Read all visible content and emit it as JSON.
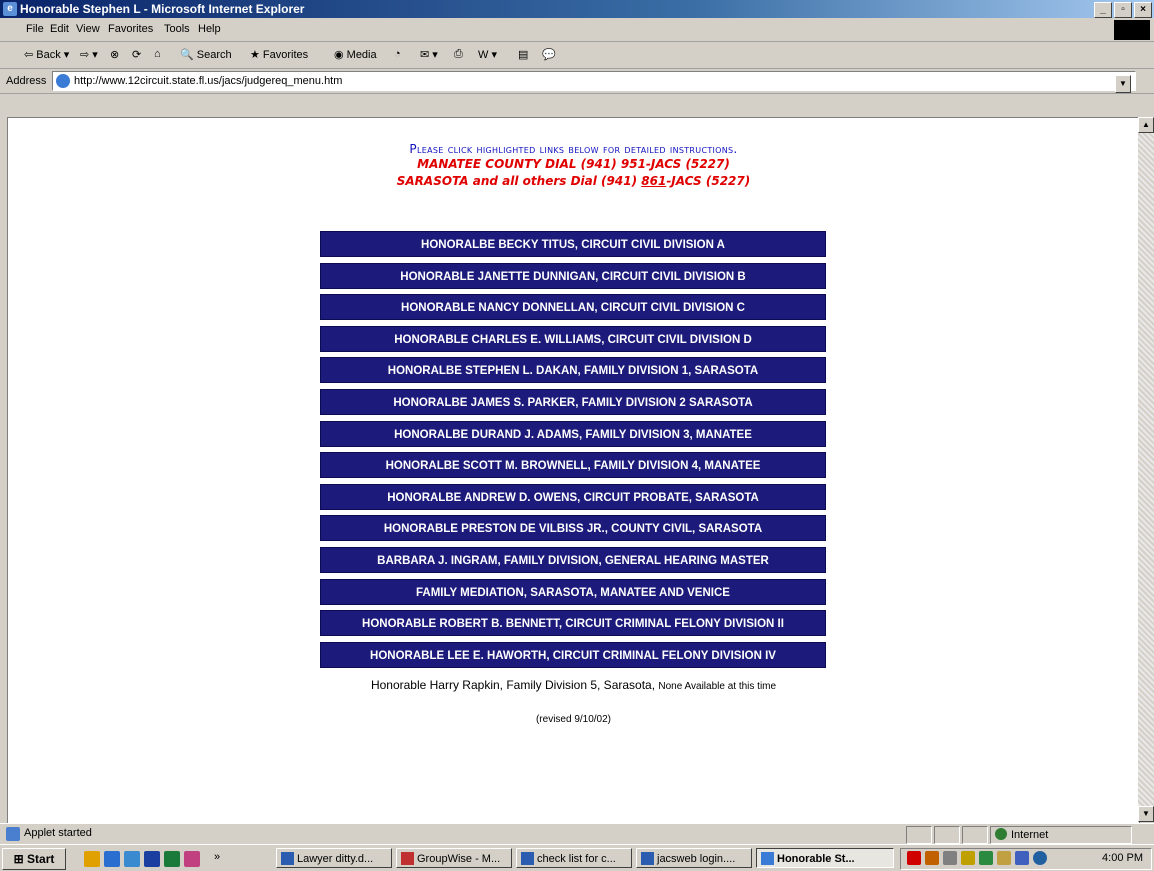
{
  "window": {
    "title": "Honorable Stephen L - Microsoft Internet Explorer"
  },
  "menu": [
    "File",
    "Edit",
    "View",
    "Favorites",
    "Tools",
    "Help"
  ],
  "toolbar": {
    "back": "Back",
    "search": "Search",
    "favorites": "Favorites",
    "media": "Media"
  },
  "address": {
    "label": "Address",
    "url": "http://www.12circuit.state.fl.us/jacs/judgereq_menu.htm"
  },
  "page": {
    "heading": "Please click highlighted links below for detailed instructions.",
    "line2": "MANATEE COUNTY DIAL (941) 951-JACS (5227)",
    "line3_a": "SARASOTA and all others Dial (941) ",
    "line3_b": "861",
    "line3_c": "-JACS (5227)",
    "buttons": [
      "HONORALBE BECKY TITUS, CIRCUIT CIVIL DIVISION A",
      "HONORABLE JANETTE DUNNIGAN, CIRCUIT CIVIL DIVISION B",
      "HONORABLE NANCY DONNELLAN, CIRCUIT CIVIL DIVISION C",
      "HONORABLE CHARLES E. WILLIAMS, CIRCUIT CIVIL DIVISION D",
      "HONORALBE STEPHEN L. DAKAN, FAMILY DIVISION 1, SARASOTA",
      "HONORALBE JAMES S. PARKER, FAMILY DIVISION 2 SARASOTA",
      "HONORALBE DURAND J. ADAMS, FAMILY DIVISION 3, MANATEE",
      "HONORALBE SCOTT M. BROWNELL, FAMILY DIVISION 4, MANATEE",
      "HONORALBE ANDREW D. OWENS, CIRCUIT PROBATE, SARASOTA",
      "HONORABLE PRESTON DE VILBISS JR., COUNTY CIVIL, SARASOTA",
      "BARBARA J. INGRAM, FAMILY DIVISION, GENERAL HEARING MASTER",
      "FAMILY MEDIATION, SARASOTA, MANATEE AND VENICE",
      "HONORABLE ROBERT B. BENNETT, CIRCUIT CRIMINAL FELONY DIVISION II",
      "HONORABLE LEE E. HAWORTH, CIRCUIT CRIMINAL FELONY DIVISION IV"
    ],
    "note_main": "Honorable Harry Rapkin, Family Division 5, Sarasota, ",
    "note_small": "None Available at this time",
    "revised": "(revised 9/10/02)"
  },
  "status": {
    "text": "Applet started",
    "zone": "Internet"
  },
  "taskbar": {
    "start": "Start",
    "tasks": [
      "Lawyer ditty.d...",
      "GroupWise - M...",
      "check list for c...",
      "jacsweb login....",
      "Honorable St..."
    ],
    "clock": "4:00 PM"
  }
}
